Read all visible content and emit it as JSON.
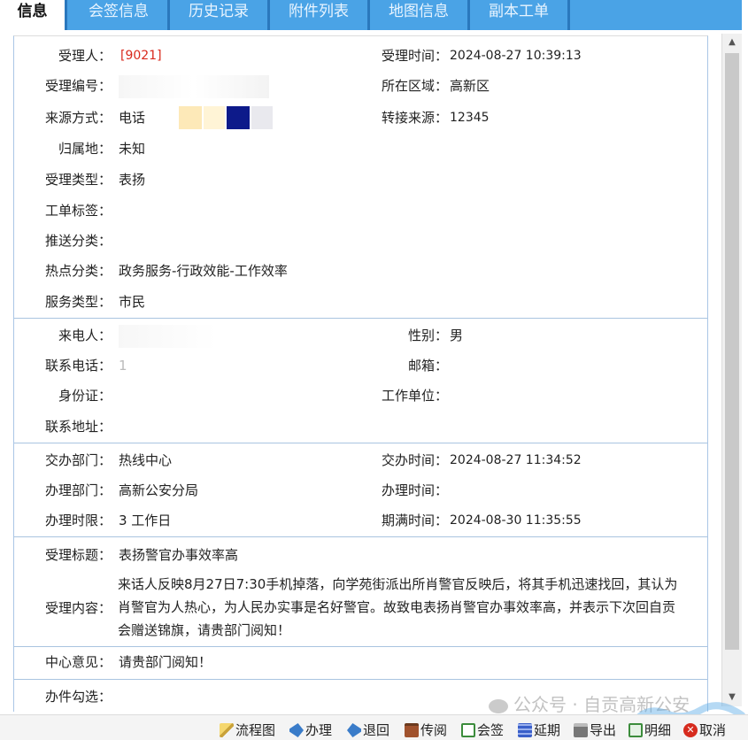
{
  "tabs": [
    {
      "label": "信息"
    },
    {
      "label": "会签信息"
    },
    {
      "label": "历史记录"
    },
    {
      "label": "附件列表"
    },
    {
      "label": "地图信息"
    },
    {
      "label": "副本工单"
    }
  ],
  "acceptance": {
    "handler_label": "受理人：",
    "handler_value": "[9021]",
    "accept_time_label": "受理时间：",
    "accept_time_value": "2024-08-27 10:39:13",
    "accept_no_label": "受理编号：",
    "accept_no_value": "",
    "region_label": "所在区域：",
    "region_value": "高新区",
    "source_label": "来源方式：",
    "source_value": "电话",
    "transfer_label": "转接来源：",
    "transfer_value": "12345",
    "origin_label": "归属地：",
    "origin_value": "未知",
    "type_label": "受理类型：",
    "type_value": "表扬",
    "tag_label": "工单标签：",
    "tag_value": "",
    "push_label": "推送分类：",
    "push_value": "",
    "hot_label": "热点分类：",
    "hot_value": "政务服务-行政效能-工作效率",
    "service_label": "服务类型：",
    "service_value": "市民"
  },
  "caller": {
    "name_label": "来电人：",
    "name_value": "",
    "gender_label": "性别：",
    "gender_value": "男",
    "phone_label": "联系电话：",
    "phone_value": "1",
    "email_label": "邮箱：",
    "email_value": "",
    "id_label": "身份证：",
    "id_value": "",
    "work_label": "工作单位：",
    "work_value": "",
    "address_label": "联系地址：",
    "address_value": ""
  },
  "assign": {
    "dept_label": "交办部门：",
    "dept_value": "热线中心",
    "assign_time_label": "交办时间：",
    "assign_time_value": "2024-08-27 11:34:52",
    "handle_dept_label": "办理部门：",
    "handle_dept_value": "高新公安分局",
    "handle_time_label": "办理时间：",
    "handle_time_value": "",
    "limit_label": "办理时限：",
    "limit_value": "3 工作日",
    "due_label": "期满时间：",
    "due_value": "2024-08-30 11:35:55"
  },
  "detail": {
    "title_label": "受理标题：",
    "title_value": "表扬警官办事效率高",
    "content_label": "受理内容：",
    "content_value": "来话人反映8月27日7:30手机掉落，向学苑街派出所肖警官反映后，将其手机迅速找回，其认为肖警官为人热心，为人民办实事是名好警官。故致电表扬肖警官办事效率高，并表示下次回自贡会赠送锦旗，请贵部门阅知！",
    "opinion_label": "中心意见：",
    "opinion_value": "请贵部门阅知！",
    "check_label": "办件勾选：",
    "check_value": ""
  },
  "toolbar": [
    {
      "label": "流程图",
      "icon": "pencil-icon",
      "color": "#c9a23a"
    },
    {
      "label": "办理",
      "icon": "handle-icon",
      "color": "#3a7cc9"
    },
    {
      "label": "退回",
      "icon": "return-icon",
      "color": "#3a7cc9"
    },
    {
      "label": "传阅",
      "icon": "briefcase-icon",
      "color": "#a0522d"
    },
    {
      "label": "会签",
      "icon": "countersign-icon",
      "color": "#3c8c3c"
    },
    {
      "label": "延期",
      "icon": "delay-icon",
      "color": "#3a5fc9"
    },
    {
      "label": "导出",
      "icon": "print-icon",
      "color": "#555555"
    },
    {
      "label": "明细",
      "icon": "detail-icon",
      "color": "#3c8c3c"
    },
    {
      "label": "取消",
      "icon": "cancel-icon",
      "color": "#d62b1e"
    }
  ],
  "watermark": {
    "text": "公众号 · 自贡高新公安"
  }
}
